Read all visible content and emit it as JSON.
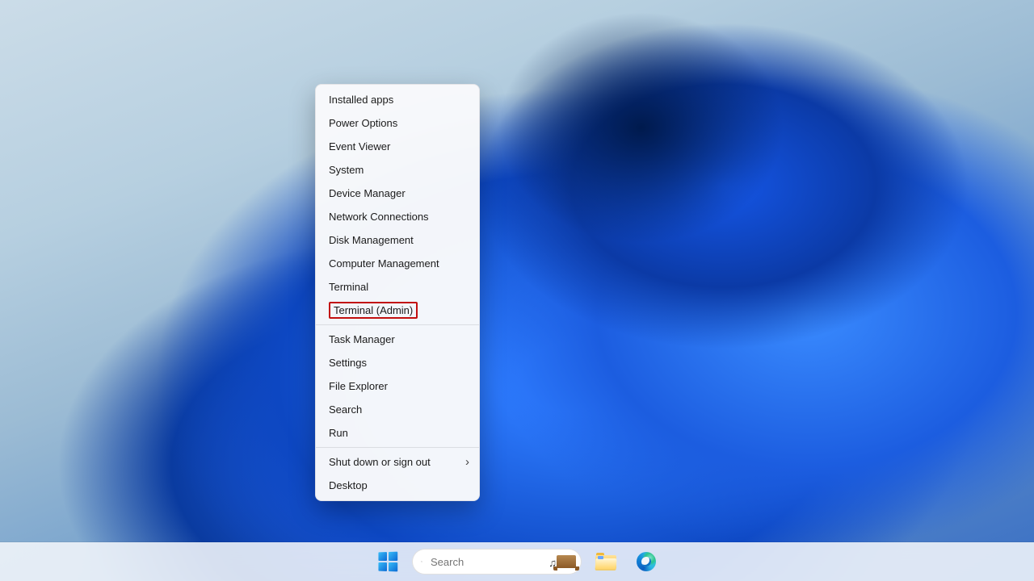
{
  "context_menu": {
    "items": [
      {
        "label": "Installed apps",
        "separator_after": false,
        "highlighted": false,
        "submenu": false,
        "name": "ctx-installed-apps"
      },
      {
        "label": "Power Options",
        "separator_after": false,
        "highlighted": false,
        "submenu": false,
        "name": "ctx-power-options"
      },
      {
        "label": "Event Viewer",
        "separator_after": false,
        "highlighted": false,
        "submenu": false,
        "name": "ctx-event-viewer"
      },
      {
        "label": "System",
        "separator_after": false,
        "highlighted": false,
        "submenu": false,
        "name": "ctx-system"
      },
      {
        "label": "Device Manager",
        "separator_after": false,
        "highlighted": false,
        "submenu": false,
        "name": "ctx-device-manager"
      },
      {
        "label": "Network Connections",
        "separator_after": false,
        "highlighted": false,
        "submenu": false,
        "name": "ctx-network-connections"
      },
      {
        "label": "Disk Management",
        "separator_after": false,
        "highlighted": false,
        "submenu": false,
        "name": "ctx-disk-management"
      },
      {
        "label": "Computer Management",
        "separator_after": false,
        "highlighted": false,
        "submenu": false,
        "name": "ctx-computer-management"
      },
      {
        "label": "Terminal",
        "separator_after": false,
        "highlighted": false,
        "submenu": false,
        "name": "ctx-terminal"
      },
      {
        "label": "Terminal (Admin)",
        "separator_after": true,
        "highlighted": true,
        "submenu": false,
        "name": "ctx-terminal-admin"
      },
      {
        "label": "Task Manager",
        "separator_after": false,
        "highlighted": false,
        "submenu": false,
        "name": "ctx-task-manager"
      },
      {
        "label": "Settings",
        "separator_after": false,
        "highlighted": false,
        "submenu": false,
        "name": "ctx-settings"
      },
      {
        "label": "File Explorer",
        "separator_after": false,
        "highlighted": false,
        "submenu": false,
        "name": "ctx-file-explorer"
      },
      {
        "label": "Search",
        "separator_after": false,
        "highlighted": false,
        "submenu": false,
        "name": "ctx-search"
      },
      {
        "label": "Run",
        "separator_after": true,
        "highlighted": false,
        "submenu": false,
        "name": "ctx-run"
      },
      {
        "label": "Shut down or sign out",
        "separator_after": false,
        "highlighted": false,
        "submenu": true,
        "name": "ctx-shutdown-signout"
      },
      {
        "label": "Desktop",
        "separator_after": false,
        "highlighted": false,
        "submenu": false,
        "name": "ctx-desktop"
      }
    ]
  },
  "taskbar": {
    "search": {
      "placeholder": "Search"
    },
    "pinned": [
      {
        "name": "start-button",
        "icon": "windows-logo-icon"
      },
      {
        "name": "search-box",
        "icon": "search-icon"
      },
      {
        "name": "file-explorer-button",
        "icon": "file-explorer-icon"
      },
      {
        "name": "edge-button",
        "icon": "edge-icon"
      }
    ]
  },
  "colors": {
    "highlight_border": "#c20f0f",
    "accent_blue": "#1069d3"
  }
}
